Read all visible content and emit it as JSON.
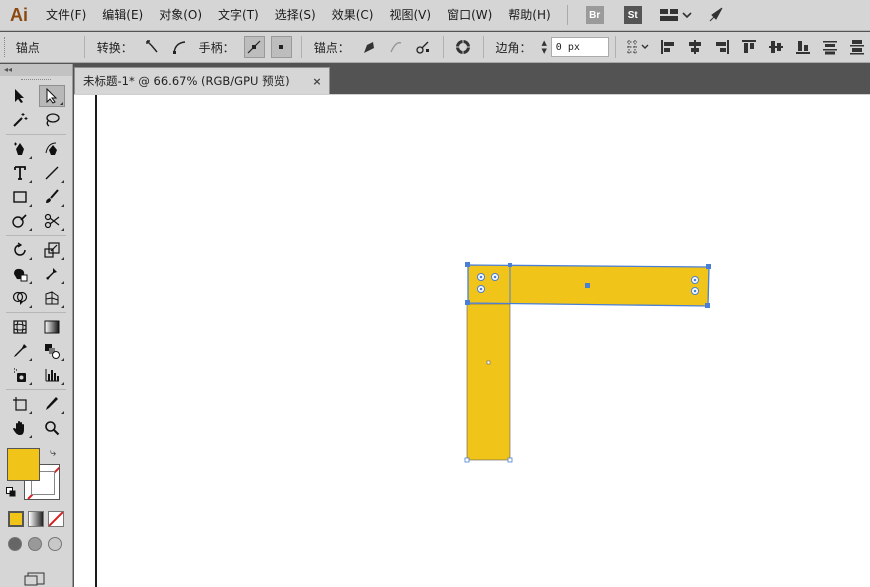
{
  "app": {
    "logo": "Ai"
  },
  "menu": {
    "items": [
      "文件(F)",
      "编辑(E)",
      "对象(O)",
      "文字(T)",
      "选择(S)",
      "效果(C)",
      "视图(V)",
      "窗口(W)",
      "帮助(H)"
    ],
    "bridge_badge": "Br",
    "stock_badge": "St",
    "layout_icon": "workspace-grid-icon",
    "gpu_icon": "rocket-icon"
  },
  "control_bar": {
    "mode_label": "锚点",
    "convert_label": "转换：",
    "handles_label": "手柄：",
    "anchors_label": "锚点：",
    "corner_label": "边角：",
    "corner_value": "0 px"
  },
  "document": {
    "tab_title": "未标题-1* @ 66.67% (RGB/GPU 预览)",
    "close_glyph": "×"
  },
  "colors": {
    "fill": "#f0c419",
    "selection": "#4a7fd6",
    "stroke_none": "#d91f1f",
    "menu_bg": "#d5d5d5",
    "logo": "#8b4a12"
  },
  "tools": {
    "active": "direct-selection-tool"
  }
}
